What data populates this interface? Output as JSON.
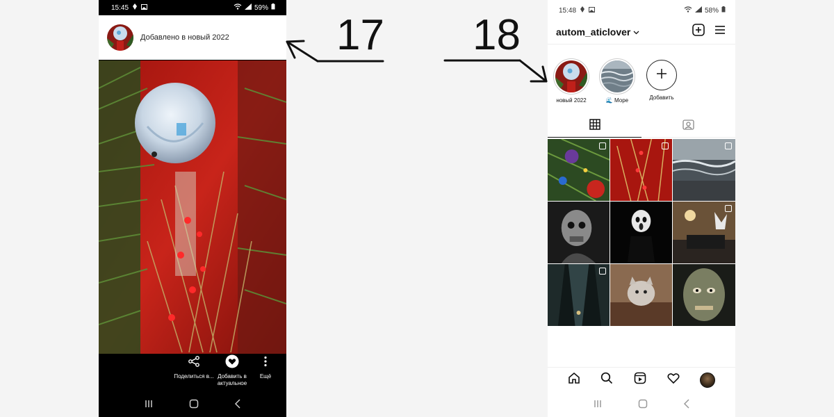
{
  "left_phone": {
    "status_time": "15:45",
    "battery": "59%",
    "added_text": "Добавлено в новый 2022",
    "actions": [
      {
        "label": "Поделиться в...",
        "icon": "share-icon"
      },
      {
        "label": "Добавить в актуальное",
        "icon": "heart-circle-icon"
      },
      {
        "label": "Ещё",
        "icon": "more-vertical-icon"
      }
    ]
  },
  "right_phone": {
    "status_time": "15:48",
    "battery": "58%",
    "username": "autom_aticlover",
    "highlights": [
      {
        "label": "новый 2022"
      },
      {
        "label": "🌊 Море"
      },
      {
        "label": "Добавить"
      }
    ]
  },
  "annotations": {
    "left_number": "17",
    "right_number": "18"
  }
}
